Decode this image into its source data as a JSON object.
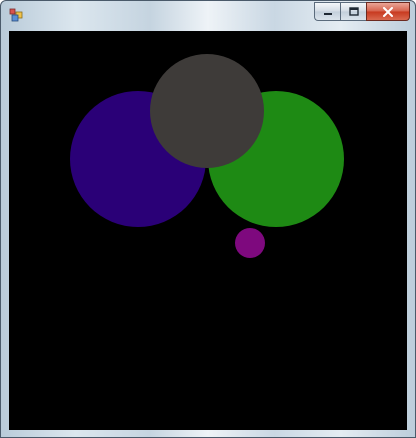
{
  "window": {
    "icon": "app-icon",
    "controls": [
      "minimize-icon",
      "maximize-icon",
      "close-icon"
    ]
  },
  "canvas": {
    "background": "#000000",
    "circles": [
      {
        "name": "purple-circle",
        "color": "#2a0077"
      },
      {
        "name": "green-circle",
        "color": "#1e8a14"
      },
      {
        "name": "gray-circle",
        "color": "#3e3b39"
      },
      {
        "name": "magenta-circle",
        "color": "#7e097e"
      }
    ]
  }
}
